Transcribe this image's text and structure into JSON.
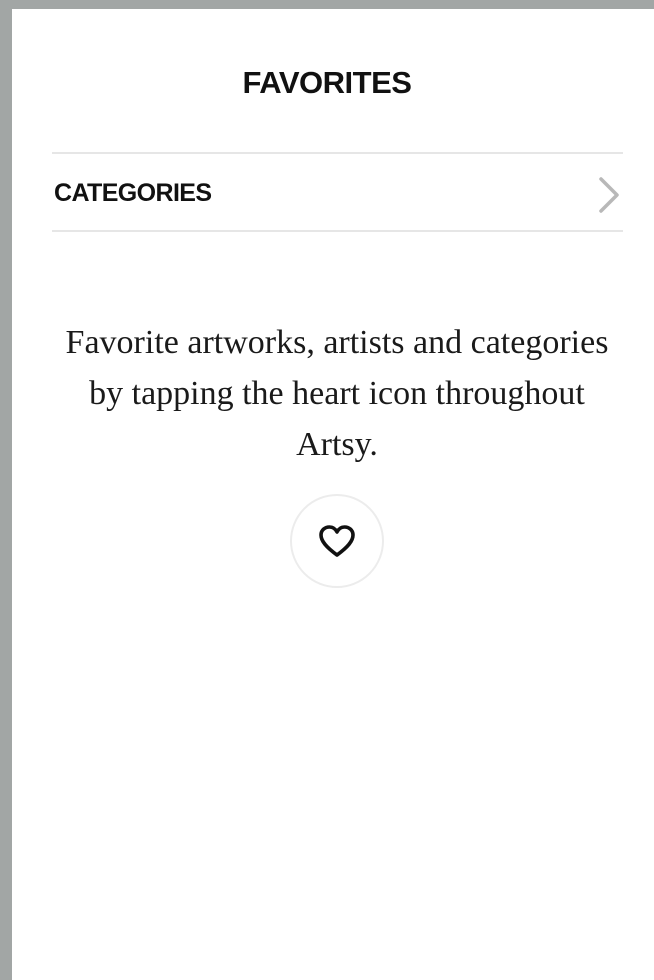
{
  "header": {
    "title": "FAVORITES"
  },
  "categories_row": {
    "label": "CATEGORIES",
    "icon": "chevron-right-icon"
  },
  "empty_state": {
    "message": "Favorite artworks, artists and categories by tapping the heart icon throughout Artsy.",
    "button_icon": "heart-icon"
  },
  "colors": {
    "background": "#ffffff",
    "outer_background": "#a2a6a5",
    "divider": "#e6e6e6",
    "text": "#111111",
    "chevron": "#b8b8b8"
  }
}
